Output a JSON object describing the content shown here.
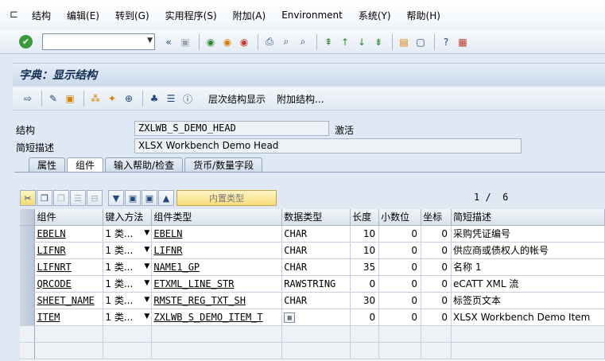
{
  "menu": [
    "结构",
    "编辑(E)",
    "转到(G)",
    "实用程序(S)",
    "附加(A)",
    "Environment",
    "系统(Y)",
    "帮助(H)"
  ],
  "toolbar": {
    "command_value": ""
  },
  "title": "字典：显示结构",
  "app_toolbar": {
    "hierarchy_label": "层次结构显示",
    "append_label": "附加结构..."
  },
  "header": {
    "structure_label": "结构",
    "structure_value": "ZXLWB_S_DEMO_HEAD",
    "status": "激活",
    "desc_label": "简短描述",
    "desc_value": "XLSX Workbench Demo Head"
  },
  "tabs": [
    "属性",
    "组件",
    "输入帮助/检查",
    "货币/数量字段"
  ],
  "grid_toolbar": {
    "builtin_label": "内置类型"
  },
  "pager": "1 /  6",
  "grid": {
    "headers": [
      "组件",
      "键入方法",
      "组件类型",
      "数据类型",
      "长度",
      "小数位",
      "坐标",
      "简短描述"
    ],
    "rows": [
      {
        "comp": "EBELN",
        "typing": "1 类...",
        "ctype": "EBELN",
        "dtype": "CHAR",
        "len": "10",
        "dec": "0",
        "coord": "0",
        "desc": "采购凭证编号"
      },
      {
        "comp": "LIFNR",
        "typing": "1 类...",
        "ctype": "LIFNR",
        "dtype": "CHAR",
        "len": "10",
        "dec": "0",
        "coord": "0",
        "desc": "供应商或债权人的帐号"
      },
      {
        "comp": "LIFNRT",
        "typing": "1 类...",
        "ctype": "NAME1_GP",
        "dtype": "CHAR",
        "len": "35",
        "dec": "0",
        "coord": "0",
        "desc": "名称 1"
      },
      {
        "comp": "QRCODE",
        "typing": "1 类...",
        "ctype": "ETXML_LINE_STR",
        "dtype": "RAWSTRING",
        "len": "0",
        "dec": "0",
        "coord": "0",
        "desc": "eCATT XML 流"
      },
      {
        "comp": "SHEET_NAME",
        "typing": "1 类...",
        "ctype": "RMSTE_REG_TXT_SH",
        "dtype": "CHAR",
        "len": "30",
        "dec": "0",
        "coord": "0",
        "desc": "标签页文本"
      },
      {
        "comp": "ITEM",
        "typing": "1 类...",
        "ctype": "ZXLWB_S_DEMO_ITEM_T",
        "dtype": "",
        "len": "0",
        "dec": "0",
        "coord": "0",
        "desc": "XLSX Workbench Demo Item"
      }
    ]
  }
}
